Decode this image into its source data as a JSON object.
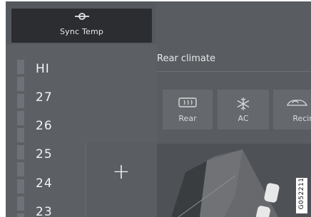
{
  "sync": {
    "label": "Sync Temp",
    "icon": "sync-temp-icon"
  },
  "temperature": {
    "items": [
      "HI",
      "27",
      "26",
      "25",
      "24",
      "23"
    ],
    "plus_label": "+"
  },
  "rear_climate": {
    "title": "Rear climate",
    "buttons": [
      {
        "label": "Rear",
        "icon": "rear-defrost-icon"
      },
      {
        "label": "AC",
        "icon": "snowflake-icon"
      },
      {
        "label": "Recirc",
        "icon": "recirculation-icon"
      }
    ]
  },
  "figure_code": "G052211"
}
